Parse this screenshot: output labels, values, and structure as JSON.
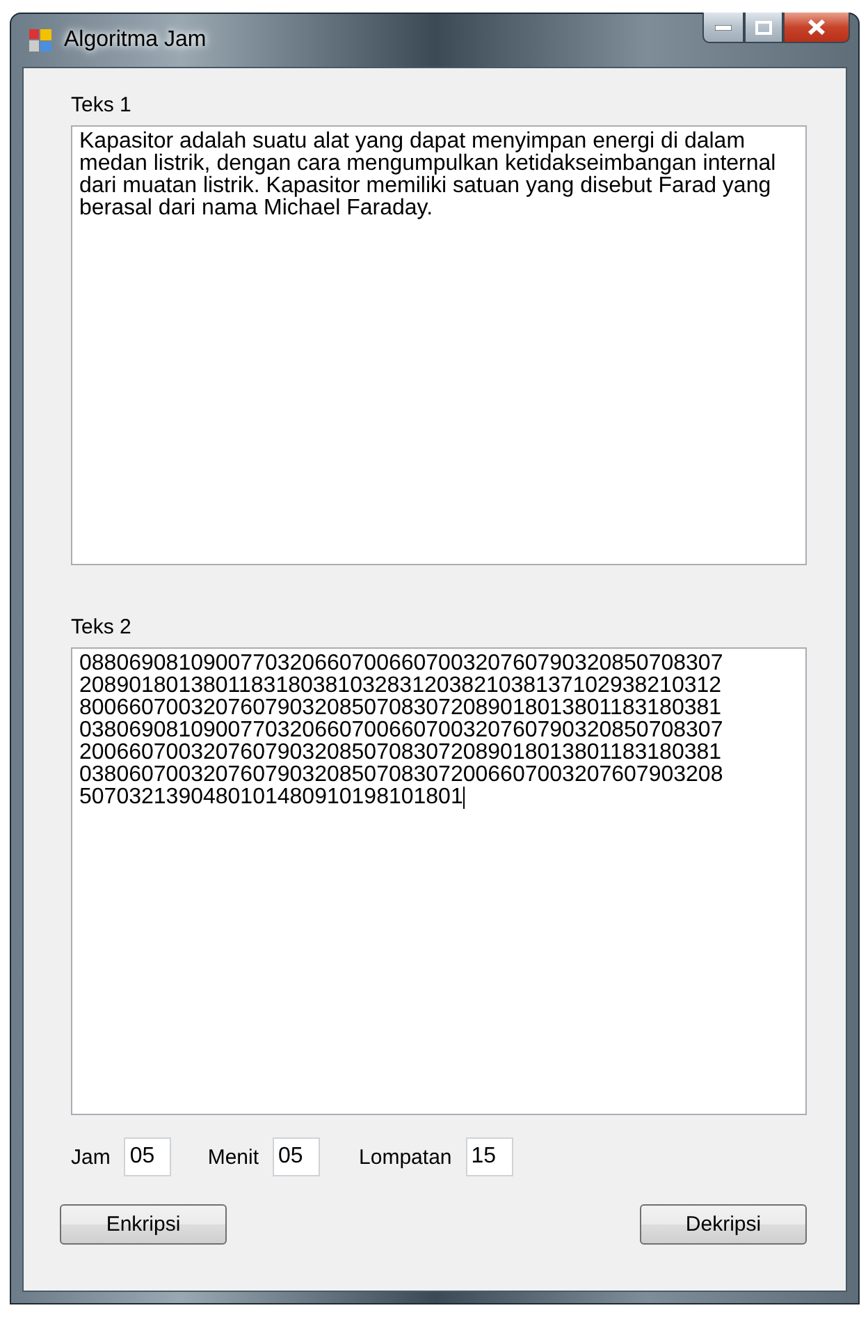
{
  "window": {
    "title": "Algoritma Jam"
  },
  "fields": [
    {
      "label": "Teks 1",
      "value": "Kapasitor adalah suatu alat yang dapat menyimpan energi di dalam medan listrik, dengan cara mengumpulkan ketidakseimbangan internal dari muatan listrik. Kapasitor memiliki satuan yang disebut Farad yang berasal dari nama Michael Faraday."
    },
    {
      "label": "Teks 2",
      "value": "0880690810900770320660700660700320760790320850708307\n2089018013801183180381032831203821038137102938210312\n8006607003207607903208507083072089018013801183180381\n0380690810900770320660700660700320760790320850708307\n2006607003207607903208507083072089018013801183180381\n0380607003207607903208507083072006607003207607903208\n5070321390480101480910198101801"
    }
  ],
  "params": [
    {
      "label": "Jam",
      "value": "05"
    },
    {
      "label": "Menit",
      "value": "05"
    },
    {
      "label": "Lompatan",
      "value": "15"
    }
  ],
  "buttons": [
    "Enkripsi",
    "Dekripsi"
  ]
}
